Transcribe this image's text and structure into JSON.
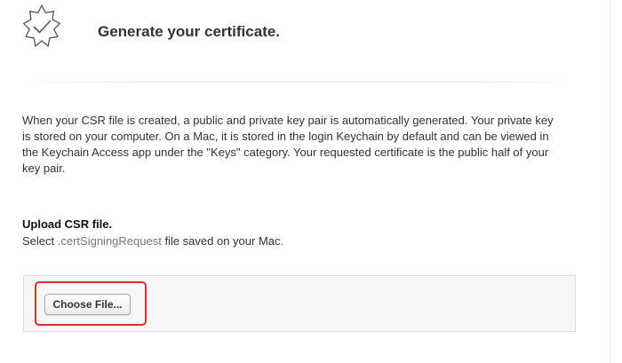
{
  "header": {
    "icon": "certificate-badge-check-icon",
    "title": "Generate your certificate."
  },
  "description": "When your CSR file is created, a public and private key pair is automatically generated. Your private key is stored on your computer. On a Mac, it is stored in the login Keychain by default and can be viewed in the Keychain Access app under the \"Keys\" category. Your requested certificate is the public half of your key pair.",
  "upload": {
    "heading": "Upload CSR file.",
    "help_prefix": "Select ",
    "help_filetype": ".certSigningRequest",
    "help_suffix": " file saved on your Mac.",
    "button_label": "Choose File..."
  },
  "colors": {
    "highlight_border": "#e8282a",
    "icon_stroke": "#555555",
    "panel_background": "#f7f7f7"
  }
}
